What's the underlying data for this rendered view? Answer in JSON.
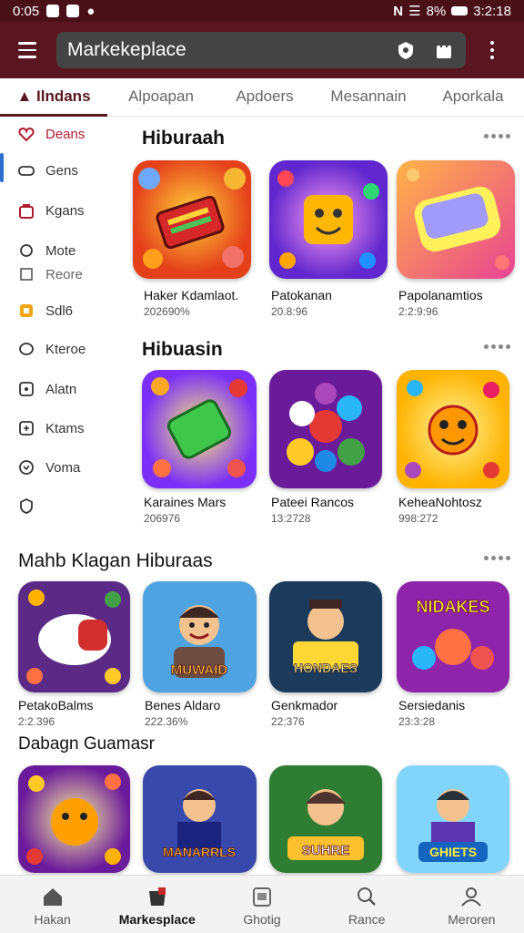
{
  "status_bar": {
    "time": "0:05",
    "battery": "8%",
    "clock": "3:2:18",
    "carrier": "N"
  },
  "app_bar": {
    "search_value": "Markekeplace"
  },
  "tabs": [
    {
      "label": "Ilndans",
      "active": true
    },
    {
      "label": "Alpoapan",
      "active": false
    },
    {
      "label": "Apdoers",
      "active": false
    },
    {
      "label": "Mesannain",
      "active": false
    },
    {
      "label": "Aporkala",
      "active": false
    }
  ],
  "sidebar": {
    "items": [
      {
        "label": "Deans",
        "icon": "heart-icon"
      },
      {
        "label": "Gens",
        "icon": "gamepad-icon"
      },
      {
        "label": "Kgans",
        "icon": "bag-icon"
      },
      {
        "label": "Mote",
        "icon": "circle-icon"
      },
      {
        "label": "Reore",
        "icon": "grid-icon"
      },
      {
        "label": "Sdl6",
        "icon": "badge-icon"
      },
      {
        "label": "Kteroe",
        "icon": "oval-icon"
      },
      {
        "label": "Alatn",
        "icon": "square-icon"
      },
      {
        "label": "Ktams",
        "icon": "box-icon"
      },
      {
        "label": "Voma",
        "icon": "check-circle-icon"
      },
      {
        "label": "",
        "icon": "shield-icon"
      }
    ]
  },
  "sections": [
    {
      "title": "Hiburaah",
      "apps": [
        {
          "name": "Haker Kdamlaot.",
          "sub": "202690%"
        },
        {
          "name": "Patokanan",
          "sub": "20.8:96"
        },
        {
          "name": "Papolanamtios",
          "sub": "2:2:9:96"
        }
      ]
    },
    {
      "title": "Hibuasin",
      "apps": [
        {
          "name": "Karaines Mars",
          "sub": "206976"
        },
        {
          "name": "Pateei Rancos",
          "sub": "13:2728"
        },
        {
          "name": "KeheaNohtosz",
          "sub": "998:272"
        }
      ]
    },
    {
      "title": "Mahb Klagan Hiburaas",
      "apps": [
        {
          "name": "PetakoBalms",
          "sub": "2:2.396"
        },
        {
          "name": "Benes Aldaro",
          "sub": "222.36%"
        },
        {
          "name": "Genkmador",
          "sub": "22:376"
        },
        {
          "name": "Sersiedanis",
          "sub": "23:3:28"
        }
      ],
      "tile_text": [
        "",
        "MUWAID",
        "HONDAES",
        "NIDAKES"
      ]
    },
    {
      "title": "Dabagn Guamasr",
      "apps": [
        {
          "name": "",
          "sub": ""
        },
        {
          "name": "",
          "sub": ""
        },
        {
          "name": "",
          "sub": ""
        },
        {
          "name": "",
          "sub": ""
        }
      ],
      "tile_text": [
        "",
        "MANARRLS",
        "SUHRE",
        "GHIETS"
      ]
    }
  ],
  "bottom_nav": [
    {
      "label": "Hakan",
      "icon": "home-icon",
      "active": false
    },
    {
      "label": "Markesplace",
      "icon": "store-icon",
      "active": true
    },
    {
      "label": "Ghotig",
      "icon": "library-icon",
      "active": false
    },
    {
      "label": "Rance",
      "icon": "search-people-icon",
      "active": false
    },
    {
      "label": "Meroren",
      "icon": "person-icon",
      "active": false
    }
  ],
  "colors": {
    "app_bar": "#5a1620",
    "status_bar": "#4a1018",
    "tab_active": "#5a1620",
    "accent_blue": "#2d6fd1"
  }
}
